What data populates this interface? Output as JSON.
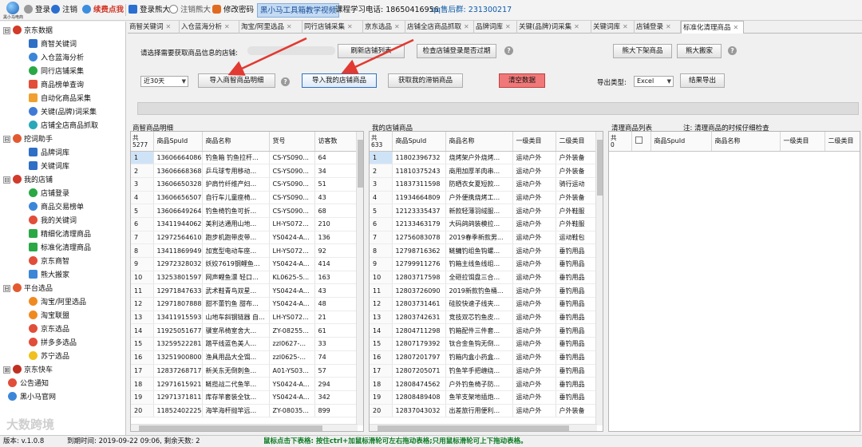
{
  "app": {
    "logo_text": "黑小马电商"
  },
  "toolbar": {
    "login": "登录",
    "logout": "注销",
    "renew": "续费点我",
    "login_sub": "登录熊大",
    "logout_sub": "注销熊大",
    "change_pwd": "修改密码",
    "video": "黑小马工具箱教学视频",
    "phone": "课程学习电话: 18650416956",
    "qq": "qq售后群: 231300217"
  },
  "tabs": [
    "商智关键词",
    "入仓蓝海分析",
    "淘宝/阿里选品",
    "同行店铺采集",
    "京东选品",
    "店铺全店商品抓取",
    "品牌词库",
    "关键(品牌)词采集",
    "关键词库",
    "店铺登录",
    "标准化清理商品"
  ],
  "sidebar": [
    {
      "type": "group",
      "label": "京东数据",
      "sign": "⊟"
    },
    {
      "type": "item",
      "label": "商智关键词"
    },
    {
      "type": "item",
      "label": "入仓蓝海分析"
    },
    {
      "type": "item",
      "label": "同行店铺采集"
    },
    {
      "type": "item",
      "label": "商品榜单查询"
    },
    {
      "type": "item",
      "label": "自动化商品采集"
    },
    {
      "type": "item",
      "label": "关键(品牌)词采集"
    },
    {
      "type": "item",
      "label": "店铺全店商品抓取"
    },
    {
      "type": "group",
      "label": "挖词助手",
      "sign": "⊟"
    },
    {
      "type": "item",
      "label": "品牌词库"
    },
    {
      "type": "item",
      "label": "关键词库"
    },
    {
      "type": "group",
      "label": "我的店铺",
      "sign": "⊟"
    },
    {
      "type": "item",
      "label": "店铺登录"
    },
    {
      "type": "item",
      "label": "商品交易榜单"
    },
    {
      "type": "item",
      "label": "我的关键词"
    },
    {
      "type": "item",
      "label": "精细化清理商品"
    },
    {
      "type": "item",
      "label": "标准化清理商品"
    },
    {
      "type": "item",
      "label": "京东商智"
    },
    {
      "type": "item",
      "label": "熊大搬家"
    },
    {
      "type": "group",
      "label": "平台选品",
      "sign": "⊟"
    },
    {
      "type": "item",
      "label": "淘宝/阿里选品"
    },
    {
      "type": "item",
      "label": "淘宝联盟"
    },
    {
      "type": "item",
      "label": "京东选品"
    },
    {
      "type": "item",
      "label": "拼多多选品"
    },
    {
      "type": "item",
      "label": "苏宁选品"
    },
    {
      "type": "group",
      "label": "京东快车",
      "sign": "⊞"
    },
    {
      "type": "item",
      "label": "公告通知"
    },
    {
      "type": "item",
      "label": "黑小马官网"
    }
  ],
  "panel": {
    "prompt": "请选择需要获取商品信息的店铺:",
    "refresh_btn": "刷新店铺列表",
    "check_btn": "检查店铺登录是否过期",
    "xiongda_down_btn": "熊大下架商品",
    "xiongda_move_btn": "熊大搬家",
    "period": "近30天",
    "import_shangzhi_btn": "导入商智商品明细",
    "import_my_btn": "导入我的店铺商品",
    "get_unsold_btn": "获取我的滞销商品",
    "clear_btn": "清空数据",
    "export_label": "导出类型:",
    "export_type": "Excel",
    "export_btn": "结果导出"
  },
  "grid1": {
    "title": "商智商品明细",
    "count_label": "共",
    "count": "5277",
    "headers": [
      "商品SpuId",
      "商品名称",
      "货号",
      "访客数"
    ],
    "rows": [
      [
        "13606664086",
        "钓鱼箱 钓鱼拉杆...",
        "CS-YS090...",
        "64"
      ],
      [
        "13606668368",
        "乒乓球专用移动...",
        "CS-YS090...",
        "34"
      ],
      [
        "13606650328",
        "护肩竹纤维产妇...",
        "CS-YS090...",
        "51"
      ],
      [
        "13606656507",
        "自行车儿童座椅...",
        "CS-YS090...",
        "43"
      ],
      [
        "13606649264",
        "钓鱼椅钓鱼可折...",
        "CS-YS090...",
        "68"
      ],
      [
        "13411944062",
        "美利达通用山地...",
        "LH-YS072...",
        "210"
      ],
      [
        "12972564610",
        "跑步机跑带皮带...",
        "YS0424-A...",
        "136"
      ],
      [
        "13411869949",
        "加宽型电动车座...",
        "LH-YS072...",
        "92"
      ],
      [
        "12972328032",
        "妖姣7619钢鲤鱼...",
        "YS0424-A...",
        "414"
      ],
      [
        "13253801597",
        "网声鲤鱼漂 轻口...",
        "KL0625-5...",
        "163"
      ],
      [
        "12971847633",
        "武术鞋青鸟双星...",
        "YS0424-A...",
        "43"
      ],
      [
        "12971807888",
        "甜不蕾钓鱼 甜布...",
        "YS0424-A...",
        "48"
      ],
      [
        "13411915593",
        "山地车斜钢链器 自...",
        "LH-YS072...",
        "21"
      ],
      [
        "11925051677",
        "骥室吊椅室舍大...",
        "ZY-08255...",
        "61"
      ],
      [
        "13259522281",
        "踏平线蓝色美人...",
        "zzl0627-...",
        "33"
      ],
      [
        "13251900800",
        "渔具用品大全饵...",
        "zzl0625-...",
        "74"
      ],
      [
        "12837268717",
        "新关东无倒刺鱼...",
        "A01-YS03...",
        "57"
      ],
      [
        "12971615921",
        "鲢揽战二代鱼竿...",
        "YS0424-A...",
        "294"
      ],
      [
        "12971371811",
        "库存竿套装全钛...",
        "YS0424-A...",
        "342"
      ],
      [
        "11852402225",
        "海竿海杆抛竿远...",
        "ZY-08035...",
        "899"
      ]
    ]
  },
  "grid2": {
    "title": "我的店铺商品",
    "count_label": "共",
    "count": "633",
    "headers": [
      "商品SpuId",
      "商品名称",
      "一级类目",
      "二级类目"
    ],
    "rows": [
      [
        "11802396732",
        "烧烤架户外烧烤...",
        "运动户外",
        "户外装备"
      ],
      [
        "11810375243",
        "商用加厚羊肉串...",
        "运动户外",
        "户外装备"
      ],
      [
        "11837311598",
        "防晒衣女夏短款...",
        "运动户外",
        "骑行运动"
      ],
      [
        "11934664809",
        "户外便携烧烤工...",
        "运动户外",
        "户外装备"
      ],
      [
        "12123335437",
        "新款轻薄羽绒服...",
        "运动户外",
        "户外鞋服"
      ],
      [
        "12133463179",
        "大码鸽鸽装模拉...",
        "运动户外",
        "户外鞋服"
      ],
      [
        "12756083078",
        "2019春季新款男...",
        "运动户外",
        "运动鞋包"
      ],
      [
        "12798716362",
        "鲢鳙钓组鱼钩螺...",
        "运动户外",
        "垂钓用品"
      ],
      [
        "12799911276",
        "钓箱主线鱼线组...",
        "运动户外",
        "垂钓用品"
      ],
      [
        "12803717598",
        "全砸拉饵盘三合...",
        "运动户外",
        "垂钓用品"
      ],
      [
        "12803726090",
        "2019新款钓鱼桶...",
        "运动户外",
        "垂钓用品"
      ],
      [
        "12803731461",
        "硅胶快速子线夹...",
        "运动户外",
        "垂钓用品"
      ],
      [
        "12803742631",
        "竞技双芯钓鱼皮...",
        "运动户外",
        "垂钓用品"
      ],
      [
        "12804711298",
        "钓箱配件三件套...",
        "运动户外",
        "垂钓用品"
      ],
      [
        "12807179392",
        "钛合金鱼钩无倒...",
        "运动户外",
        "垂钓用品"
      ],
      [
        "12807201797",
        "钓箱内盒小药盒...",
        "运动户外",
        "垂钓用品"
      ],
      [
        "12807205071",
        "钓鱼竿手把缠绕...",
        "运动户外",
        "垂钓用品"
      ],
      [
        "12808474562",
        "户外钓鱼椅子防...",
        "运动户外",
        "垂钓用品"
      ],
      [
        "12808489408",
        "鱼竿支架地插炮...",
        "运动户外",
        "垂钓用品"
      ],
      [
        "12837043032",
        "出差旅行用便利...",
        "运动户外",
        "户外装备"
      ]
    ]
  },
  "grid3": {
    "title": "清理商品列表",
    "note": "注: 清理商品的时候仔细检查",
    "count_label": "共",
    "count": "0",
    "headers": [
      "商品SpuId",
      "商品名称",
      "一级类目",
      "二级类目"
    ]
  },
  "status": {
    "version": "版本: v.1.0.8",
    "expire": "到期时间: 2019-09-22 09:06, 剩余天数: 2",
    "hint": "鼠标点击下表格: 按住ctrl+加鼠标滑轮可左右拖动表格;只用鼠标滑轮可上下拖动表格。"
  },
  "watermark": "大数跨境",
  "colors": {
    "accent": "#3a74c0",
    "arrow": "#e03a32",
    "clear_btn": "#f07878",
    "hint_text": "#0a7a22",
    "phone_text": "#0a5aa8"
  }
}
